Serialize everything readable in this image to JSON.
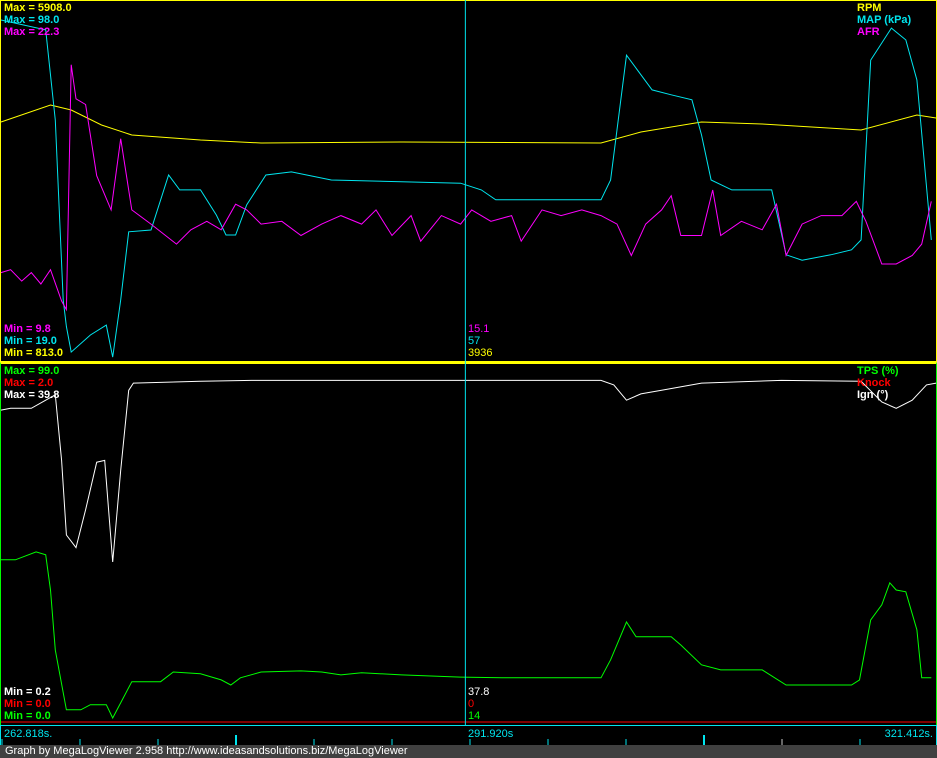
{
  "chart_data": [
    {
      "type": "line",
      "panel": "top",
      "x_unit": "s",
      "x_start": 262.818,
      "x_end": 321.412,
      "x_offset_note": "t values are seconds after start",
      "series": [
        {
          "name": "RPM",
          "color": "#ffff00",
          "min": 813.0,
          "max": 5908.0,
          "min_label": "Min = 813.0",
          "max_label": "Max = 5908.0",
          "cursor_value": "3936",
          "points": [
            [
              0,
              4191
            ],
            [
              3.1,
              4434
            ],
            [
              4.4,
              4362
            ],
            [
              6.3,
              4148
            ],
            [
              8.2,
              4005
            ],
            [
              12.5,
              3933
            ],
            [
              16.3,
              3890
            ],
            [
              25.1,
              3904
            ],
            [
              37.6,
              3890
            ],
            [
              40.1,
              4047
            ],
            [
              43.9,
              4191
            ],
            [
              47.7,
              4162
            ],
            [
              53.9,
              4076
            ],
            [
              57.4,
              4291
            ],
            [
              58.6,
              4248
            ]
          ]
        },
        {
          "name": "MAP (kPa)",
          "color": "#00e5ee",
          "min": 19.0,
          "max": 98.0,
          "min_label": "Min = 19.0",
          "max_label": "Max = 98.0",
          "cursor_value": "57",
          "points": [
            [
              0,
              94
            ],
            [
              2.8,
              91.8
            ],
            [
              3.4,
              71.8
            ],
            [
              3.9,
              31.9
            ],
            [
              4.1,
              26
            ],
            [
              4.4,
              20.3
            ],
            [
              5.6,
              24.1
            ],
            [
              6.6,
              26.3
            ],
            [
              7,
              19.2
            ],
            [
              7.5,
              31.9
            ],
            [
              8,
              47
            ],
            [
              9.4,
              47.4
            ],
            [
              10.5,
              59.6
            ],
            [
              11.2,
              56.3
            ],
            [
              12.5,
              56.3
            ],
            [
              13.5,
              50.7
            ],
            [
              14.1,
              46.3
            ],
            [
              14.7,
              46.3
            ],
            [
              15.4,
              53
            ],
            [
              16.6,
              59.6
            ],
            [
              18.2,
              60.3
            ],
            [
              20.7,
              58.5
            ],
            [
              25.1,
              58.1
            ],
            [
              28.8,
              57.8
            ],
            [
              30.1,
              56.3
            ],
            [
              31,
              54.1
            ],
            [
              32.6,
              54.1
            ],
            [
              34.5,
              54.1
            ],
            [
              37.6,
              54.1
            ],
            [
              38.2,
              58.5
            ],
            [
              39.2,
              86.2
            ],
            [
              40.8,
              78.5
            ],
            [
              42,
              77.4
            ],
            [
              43.3,
              76.3
            ],
            [
              43.9,
              68.5
            ],
            [
              44.5,
              58.5
            ],
            [
              45.8,
              56.3
            ],
            [
              48.3,
              56.3
            ],
            [
              49.2,
              41.9
            ],
            [
              50.2,
              40.7
            ],
            [
              52,
              41.9
            ],
            [
              53.3,
              43
            ],
            [
              53.9,
              45.2
            ],
            [
              54.5,
              85.1
            ],
            [
              55.8,
              92.2
            ],
            [
              56.7,
              89.6
            ],
            [
              57.4,
              80.7
            ],
            [
              58.3,
              45.2
            ]
          ]
        },
        {
          "name": "AFR",
          "color": "#ff00ff",
          "min": 9.8,
          "max": 22.3,
          "min_label": "Min = 9.8",
          "max_label": "Max = 22.3",
          "cursor_value": "15.1",
          "points": [
            [
              0,
              12.8
            ],
            [
              0.6,
              12.9
            ],
            [
              1.3,
              12.5
            ],
            [
              1.9,
              12.8
            ],
            [
              2.5,
              12.4
            ],
            [
              3.1,
              12.9
            ],
            [
              3.8,
              11.8
            ],
            [
              4.1,
              11.5
            ],
            [
              4.4,
              20.1
            ],
            [
              4.7,
              18.9
            ],
            [
              5.3,
              18.7
            ],
            [
              6,
              16.2
            ],
            [
              6.9,
              15
            ],
            [
              7.5,
              17.5
            ],
            [
              8.2,
              15
            ],
            [
              9.4,
              14.5
            ],
            [
              11,
              13.8
            ],
            [
              11.9,
              14.3
            ],
            [
              12.9,
              14.6
            ],
            [
              13.8,
              14.3
            ],
            [
              14.7,
              15.2
            ],
            [
              15.4,
              15
            ],
            [
              16.3,
              14.5
            ],
            [
              17.6,
              14.6
            ],
            [
              18.8,
              14.1
            ],
            [
              20.1,
              14.5
            ],
            [
              21.3,
              14.8
            ],
            [
              22.6,
              14.5
            ],
            [
              23.5,
              15
            ],
            [
              24.5,
              14.1
            ],
            [
              25.7,
              14.8
            ],
            [
              26.3,
              13.9
            ],
            [
              27.6,
              14.8
            ],
            [
              28.8,
              14.5
            ],
            [
              29.5,
              15
            ],
            [
              30.7,
              14.6
            ],
            [
              32,
              14.8
            ],
            [
              32.6,
              13.9
            ],
            [
              33.9,
              15
            ],
            [
              35.1,
              14.8
            ],
            [
              36.4,
              15
            ],
            [
              37.6,
              14.8
            ],
            [
              38.6,
              14.5
            ],
            [
              39.5,
              13.4
            ],
            [
              40.4,
              14.5
            ],
            [
              41.4,
              15
            ],
            [
              42,
              15.5
            ],
            [
              42.6,
              14.1
            ],
            [
              43.9,
              14.1
            ],
            [
              44.6,
              15.7
            ],
            [
              45.1,
              14.1
            ],
            [
              46.4,
              14.6
            ],
            [
              47.7,
              14.3
            ],
            [
              48.6,
              15.2
            ],
            [
              49.2,
              13.4
            ],
            [
              50.2,
              14.5
            ],
            [
              51.4,
              14.8
            ],
            [
              52.7,
              14.8
            ],
            [
              53.6,
              15.3
            ],
            [
              54.2,
              14.6
            ],
            [
              55.2,
              13.1
            ],
            [
              56.1,
              13.1
            ],
            [
              57.1,
              13.4
            ],
            [
              57.7,
              13.8
            ],
            [
              58.3,
              15.3
            ]
          ]
        }
      ]
    },
    {
      "type": "line",
      "panel": "bottom",
      "x_unit": "s",
      "x_start": 262.818,
      "x_end": 321.412,
      "series": [
        {
          "name": "TPS (%)",
          "color": "#00ff00",
          "min": 0.0,
          "max": 99.0,
          "min_label": "Min = 0.0",
          "max_label": "Max = 99.0",
          "cursor_value": "14",
          "points": [
            [
              0,
              45.1
            ],
            [
              0.9,
              45.1
            ],
            [
              2.2,
              47.3
            ],
            [
              2.8,
              46.5
            ],
            [
              3.1,
              36.7
            ],
            [
              3.4,
              20
            ],
            [
              4.1,
              3.4
            ],
            [
              5,
              3.4
            ],
            [
              5.6,
              4.8
            ],
            [
              6.6,
              4.8
            ],
            [
              7,
              1.1
            ],
            [
              8.2,
              11.2
            ],
            [
              10,
              11.2
            ],
            [
              10.8,
              13.9
            ],
            [
              12.5,
              13.4
            ],
            [
              13.8,
              11.7
            ],
            [
              14.4,
              10.3
            ],
            [
              15,
              12.3
            ],
            [
              16.3,
              13.9
            ],
            [
              18.8,
              14.2
            ],
            [
              20.1,
              13.9
            ],
            [
              21.3,
              13.1
            ],
            [
              22.6,
              13.7
            ],
            [
              25.1,
              13.1
            ],
            [
              28.8,
              12.5
            ],
            [
              31.4,
              12.3
            ],
            [
              37.6,
              12.3
            ],
            [
              38.2,
              17.3
            ],
            [
              39.2,
              27.8
            ],
            [
              39.8,
              23.7
            ],
            [
              42,
              23.7
            ],
            [
              42.6,
              21.4
            ],
            [
              43.9,
              15.9
            ],
            [
              45.1,
              14.5
            ],
            [
              47.7,
              14.5
            ],
            [
              49.2,
              10.3
            ],
            [
              53.3,
              10.3
            ],
            [
              53.8,
              11.7
            ],
            [
              54.5,
              28.4
            ],
            [
              55.2,
              32.6
            ],
            [
              55.7,
              38.7
            ],
            [
              56.1,
              36.7
            ],
            [
              56.7,
              36.2
            ],
            [
              57.4,
              25.6
            ],
            [
              57.7,
              12.3
            ],
            [
              58.3,
              12.3
            ]
          ]
        },
        {
          "name": "Knock",
          "color": "#ff0000",
          "min": 0.0,
          "max": 2.0,
          "min_label": "Min = 0.0",
          "max_label": "Max = 2.0",
          "cursor_value": "0",
          "points": [
            [
              0,
              0
            ],
            [
              58.6,
              0
            ]
          ]
        },
        {
          "name": "Ign (°)",
          "color": "#ffffff",
          "min": 0.2,
          "max": 39.8,
          "min_label": "Min = 0.2",
          "max_label": "Max = 39.8",
          "cursor_value": "37.8",
          "points": [
            [
              0,
              34.9
            ],
            [
              0.6,
              35.1
            ],
            [
              1.9,
              35.1
            ],
            [
              2.8,
              36
            ],
            [
              3.4,
              36.6
            ],
            [
              3.8,
              29.3
            ],
            [
              4.1,
              21
            ],
            [
              4.7,
              19.6
            ],
            [
              5.3,
              23.8
            ],
            [
              6,
              29.1
            ],
            [
              6.5,
              29.3
            ],
            [
              7,
              18
            ],
            [
              7.5,
              28.2
            ],
            [
              8,
              37.1
            ],
            [
              8.3,
              37.9
            ],
            [
              12.5,
              38.1
            ],
            [
              15.7,
              38.2
            ],
            [
              37.6,
              38.2
            ],
            [
              38.4,
              37.7
            ],
            [
              39.2,
              36
            ],
            [
              40.1,
              36.7
            ],
            [
              41.4,
              37.1
            ],
            [
              43.9,
              37.9
            ],
            [
              48.9,
              38.2
            ],
            [
              53.9,
              38.1
            ],
            [
              55.2,
              35.8
            ],
            [
              56.1,
              35.1
            ],
            [
              57.1,
              36
            ],
            [
              58,
              37.7
            ],
            [
              58.6,
              37.9
            ]
          ]
        }
      ]
    }
  ],
  "cursor": {
    "time_label": "291.920s",
    "t": 29.1
  },
  "axis": {
    "start_label": "262.818s.",
    "end_label": "321.412s."
  },
  "footer": "Graph by MegaLogViewer 2.958 http://www.ideasandsolutions.biz/MegaLogViewer"
}
